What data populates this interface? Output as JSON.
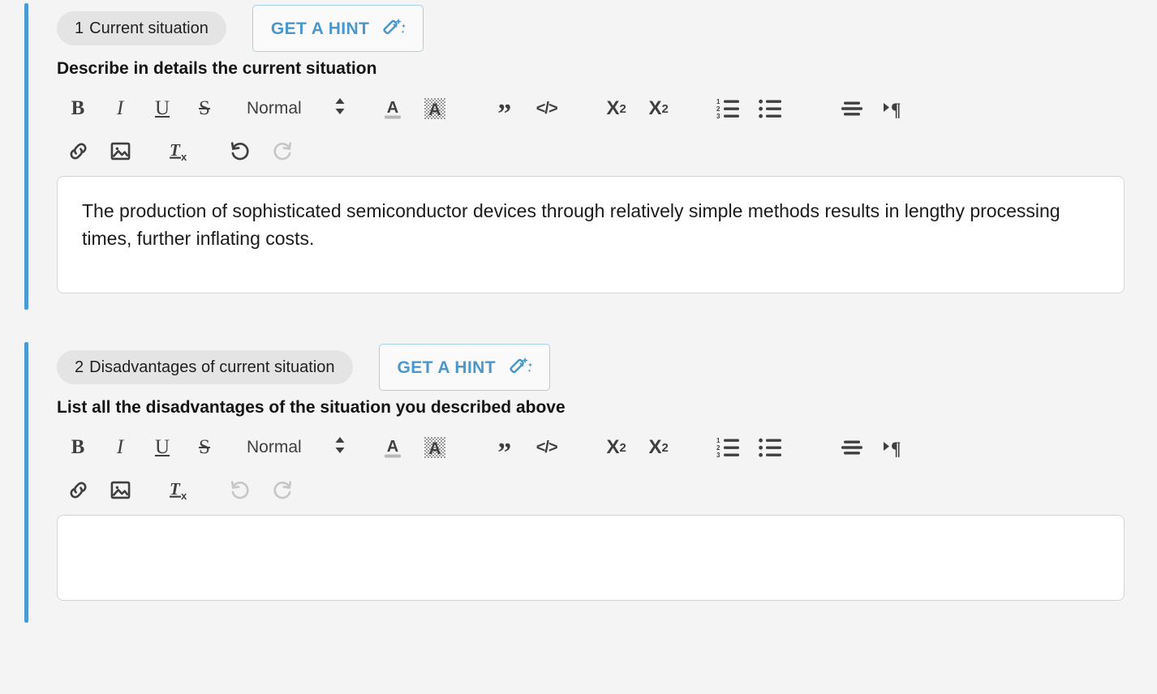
{
  "theme": {
    "accent_blue": "#4a9ad4",
    "hint_text_blue": "#4a97cd",
    "hint_border_blue": "#a8cfe8",
    "pill_bg": "#e4e4e5",
    "page_bg": "#f4f4f5",
    "editor_bg": "#ffffff",
    "editor_border": "#d4d4d6",
    "icon_color": "#3f3f3f",
    "icon_disabled_color": "#c7c7c7"
  },
  "toolbar": {
    "bold_label": "B",
    "italic_label": "I",
    "underline_label": "U",
    "strikethrough_label": "S",
    "block_format_value": "Normal",
    "font_color_label": "A",
    "highlight_color_label": "A",
    "blockquote_label": "”",
    "code_block_label": "</>",
    "subscript_label": "X",
    "subscript_index": "2",
    "superscript_label": "X",
    "superscript_index": "2",
    "ordered_list_numbers": [
      "1",
      "2",
      "3"
    ],
    "items": [
      {
        "name": "bold",
        "title": "Bold"
      },
      {
        "name": "italic",
        "title": "Italic"
      },
      {
        "name": "underline",
        "title": "Underline"
      },
      {
        "name": "strikethrough",
        "title": "Strikethrough"
      },
      {
        "name": "block-format",
        "title": "Normal"
      },
      {
        "name": "font-color",
        "title": "Font color"
      },
      {
        "name": "highlight-color",
        "title": "Highlight color"
      },
      {
        "name": "blockquote",
        "title": "Blockquote"
      },
      {
        "name": "code-block",
        "title": "Code block"
      },
      {
        "name": "subscript",
        "title": "Subscript"
      },
      {
        "name": "superscript",
        "title": "Superscript"
      },
      {
        "name": "ordered-list",
        "title": "Ordered list"
      },
      {
        "name": "bullet-list",
        "title": "Bullet list"
      },
      {
        "name": "align",
        "title": "Align"
      },
      {
        "name": "text-direction",
        "title": "Text direction"
      },
      {
        "name": "link",
        "title": "Insert link"
      },
      {
        "name": "image",
        "title": "Insert image"
      },
      {
        "name": "clear-formatting",
        "title": "Clear formatting"
      },
      {
        "name": "undo",
        "title": "Undo"
      },
      {
        "name": "redo",
        "title": "Redo"
      }
    ]
  },
  "sections": [
    {
      "number": "1",
      "pill_title": "Current situation",
      "hint_button_label": "GET A HINT",
      "field_label": "Describe in details the current situation",
      "editor_value": "The production of sophisticated semiconductor devices through relatively simple methods results in lengthy processing times, further inflating costs.",
      "editor_placeholder": "",
      "undo_enabled": true,
      "redo_enabled": false
    },
    {
      "number": "2",
      "pill_title": "Disadvantages of current situation",
      "hint_button_label": "GET A HINT",
      "field_label": "List all the disadvantages of the situation you described above",
      "editor_value": "",
      "editor_placeholder": "",
      "undo_enabled": false,
      "redo_enabled": false
    }
  ]
}
